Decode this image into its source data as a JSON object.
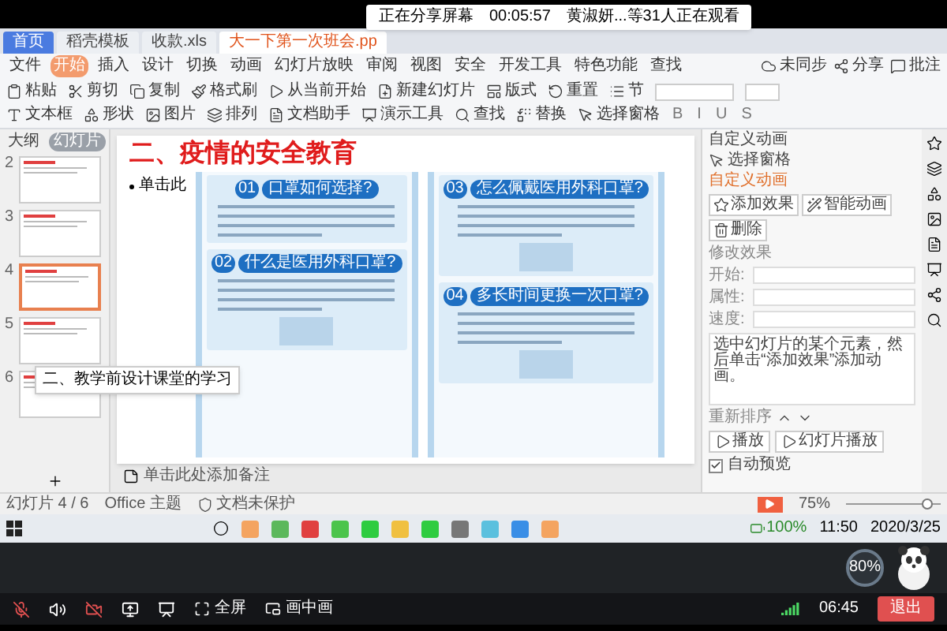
{
  "share_banner": {
    "status": "正在分享屏幕",
    "timer": "00:05:57",
    "viewers": "黄淑妍...等31人正在观看"
  },
  "window_tabs": [
    {
      "label": "首页",
      "selected": false
    },
    {
      "label": "稻壳模板",
      "selected": false
    },
    {
      "label": "收款.xls",
      "selected": false
    },
    {
      "label": "大一下第一次班会.pp",
      "selected": true
    }
  ],
  "menu": {
    "items": [
      {
        "label": "文件",
        "selected": false
      },
      {
        "label": "开始",
        "selected": true
      },
      {
        "label": "插入",
        "selected": false
      },
      {
        "label": "设计",
        "selected": false
      },
      {
        "label": "切换",
        "selected": false
      },
      {
        "label": "动画",
        "selected": false
      },
      {
        "label": "幻灯片放映",
        "selected": false
      },
      {
        "label": "审阅",
        "selected": false
      },
      {
        "label": "视图",
        "selected": false
      },
      {
        "label": "安全",
        "selected": false
      },
      {
        "label": "开发工具",
        "selected": false
      },
      {
        "label": "特色功能",
        "selected": false
      },
      {
        "label": "查找",
        "selected": false
      }
    ],
    "right": [
      "未同步",
      "分享",
      "批注"
    ]
  },
  "toolbar": {
    "row_1": [
      "粘贴",
      "剪切",
      "复制",
      "格式刷",
      "从当前开始",
      "新建幻灯片",
      "版式",
      "重置",
      "节"
    ],
    "format_buttons": [
      "B",
      "I",
      "U",
      "S"
    ],
    "row_2": [
      "文本框",
      "形状",
      "图片",
      "排列",
      "文档助手",
      "演示工具",
      "查找",
      "替换",
      "选择窗格"
    ]
  },
  "slide_panel": {
    "tabs": [
      {
        "label": "大纲",
        "selected": false
      },
      {
        "label": "幻灯片",
        "selected": true
      }
    ],
    "slides": [
      {
        "number": "2",
        "selected": false
      },
      {
        "number": "3",
        "selected": false
      },
      {
        "number": "4",
        "selected": true
      },
      {
        "number": "5",
        "selected": false
      },
      {
        "number": "6",
        "selected": false
      }
    ],
    "tooltip": "二、教学前设计课堂的学习"
  },
  "slide": {
    "title": "二、疫情的安全教育",
    "placeholder": "单击此",
    "poster": [
      {
        "number": "01",
        "heading": "口罩如何选择?",
        "photo": false
      },
      {
        "number": "02",
        "heading": "什么是医用外科口罩?",
        "photo": true
      },
      {
        "number": "03",
        "heading": "怎么佩戴医用外科口罩?",
        "photo": true
      },
      {
        "number": "04",
        "heading": "多长时间更换一次口罩?",
        "photo": true
      }
    ]
  },
  "notes": "单击此处添加备注",
  "animation_pane": {
    "title": "自定义动画",
    "selection_pane": "选择窗格",
    "heading": "自定义动画",
    "buttons": [
      "添加效果",
      "智能动画",
      "删除"
    ],
    "modify_label": "修改效果",
    "fields": [
      "开始:",
      "属性:",
      "速度:"
    ],
    "hint": "选中幻灯片的某个元素，然后单击“添加效果”添加动画。",
    "reorder": "重新排序",
    "play_buttons": [
      "播放",
      "幻灯片播放"
    ],
    "autopreview": {
      "label": "自动预览",
      "checked": true
    }
  },
  "status_bar": {
    "slide_count": "幻灯片 4 / 6",
    "theme": "Office 主题",
    "protection": "文档未保护",
    "zoom": "75%",
    "zoom_slider": {
      "level": 0.85
    }
  },
  "taskbar": {
    "battery": "100%",
    "time": "11:50",
    "date": "2020/3/25"
  },
  "net_gauge": "80%",
  "call_bar": {
    "fullscreen": "全屏",
    "pip": "画中画",
    "duration": "06:45",
    "exit": "退出"
  }
}
